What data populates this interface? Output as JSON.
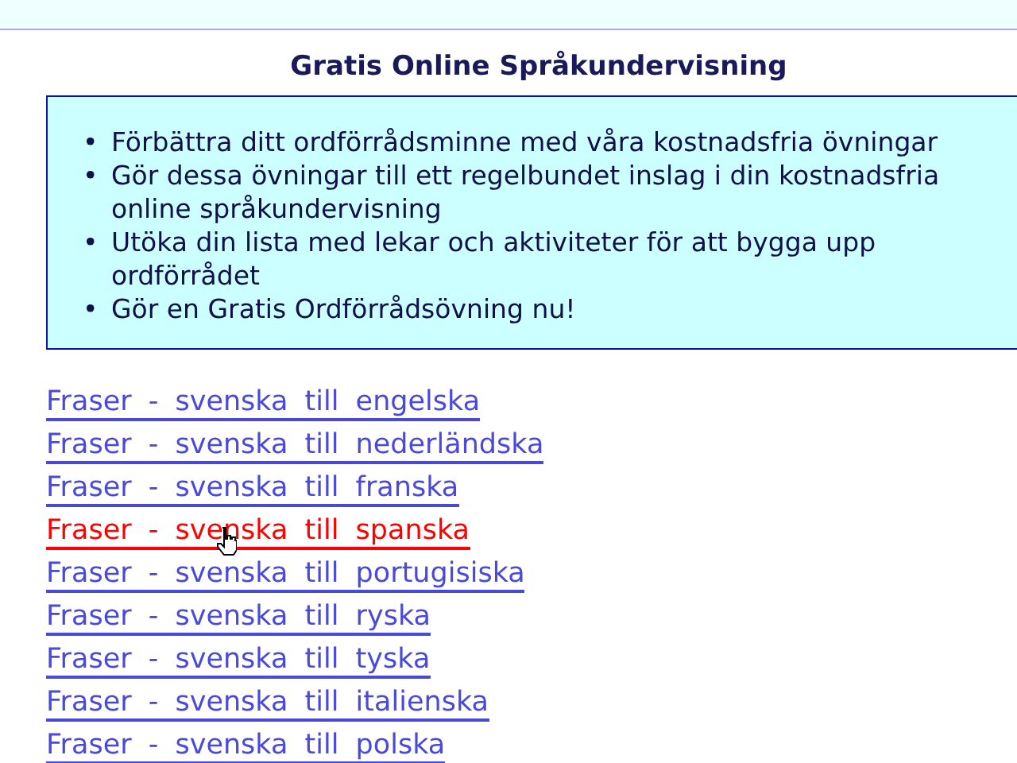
{
  "title": "Gratis Online Språkundervisning",
  "bullets": [
    {
      "marker": "•",
      "text": "Förbättra ditt ordförrådsminne med våra kostnadsfria övningar"
    },
    {
      "marker": "•",
      "text": "Gör dessa övningar till ett regelbundet inslag i din kostnadsfria online språkundervisning"
    },
    {
      "marker": "•",
      "text": "Utöka din lista med lekar och aktiviteter för att bygga upp ordförrådet"
    },
    {
      "marker": "•",
      "text": "Gör en Gratis Ordförrådsövning nu!"
    }
  ],
  "links": [
    {
      "label": "Fraser - svenska till engelska",
      "hovered": false
    },
    {
      "label": "Fraser - svenska till nederländska",
      "hovered": false
    },
    {
      "label": "Fraser - svenska till franska",
      "hovered": false
    },
    {
      "label": "Fraser - svenska till spanska",
      "hovered": true
    },
    {
      "label": "Fraser - svenska till portugisiska",
      "hovered": false
    },
    {
      "label": "Fraser - svenska till ryska",
      "hovered": false
    },
    {
      "label": "Fraser - svenska till tyska",
      "hovered": false
    },
    {
      "label": "Fraser - svenska till italienska",
      "hovered": false
    },
    {
      "label": "Fraser - svenska till polska",
      "hovered": false
    }
  ]
}
